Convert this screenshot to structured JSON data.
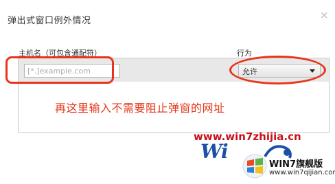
{
  "dialog": {
    "title": "弹出式窗口例外情况",
    "close_glyph": "×"
  },
  "table": {
    "host_header": "主机名（可包含通配符）",
    "action_header": "行为",
    "row": {
      "host_placeholder": "[*.]example.com",
      "action_value": "允许"
    }
  },
  "annotation": {
    "text": "再这里输入不需要阻止弹窗的网址",
    "color": "#e23a1e"
  },
  "watermark": {
    "url": "www.win7zhijia.cn",
    "logo_text": "Wi",
    "badge_title": "WIN7旗舰版",
    "badge_url": "www.win7qijian.com"
  },
  "icons": {
    "close": "close-icon",
    "dropdown": "dropdown-arrow-icon",
    "windows_flag": "windows-flag-icon"
  },
  "colors": {
    "highlight": "#e8341c",
    "row_background": "#e8e8e8"
  }
}
